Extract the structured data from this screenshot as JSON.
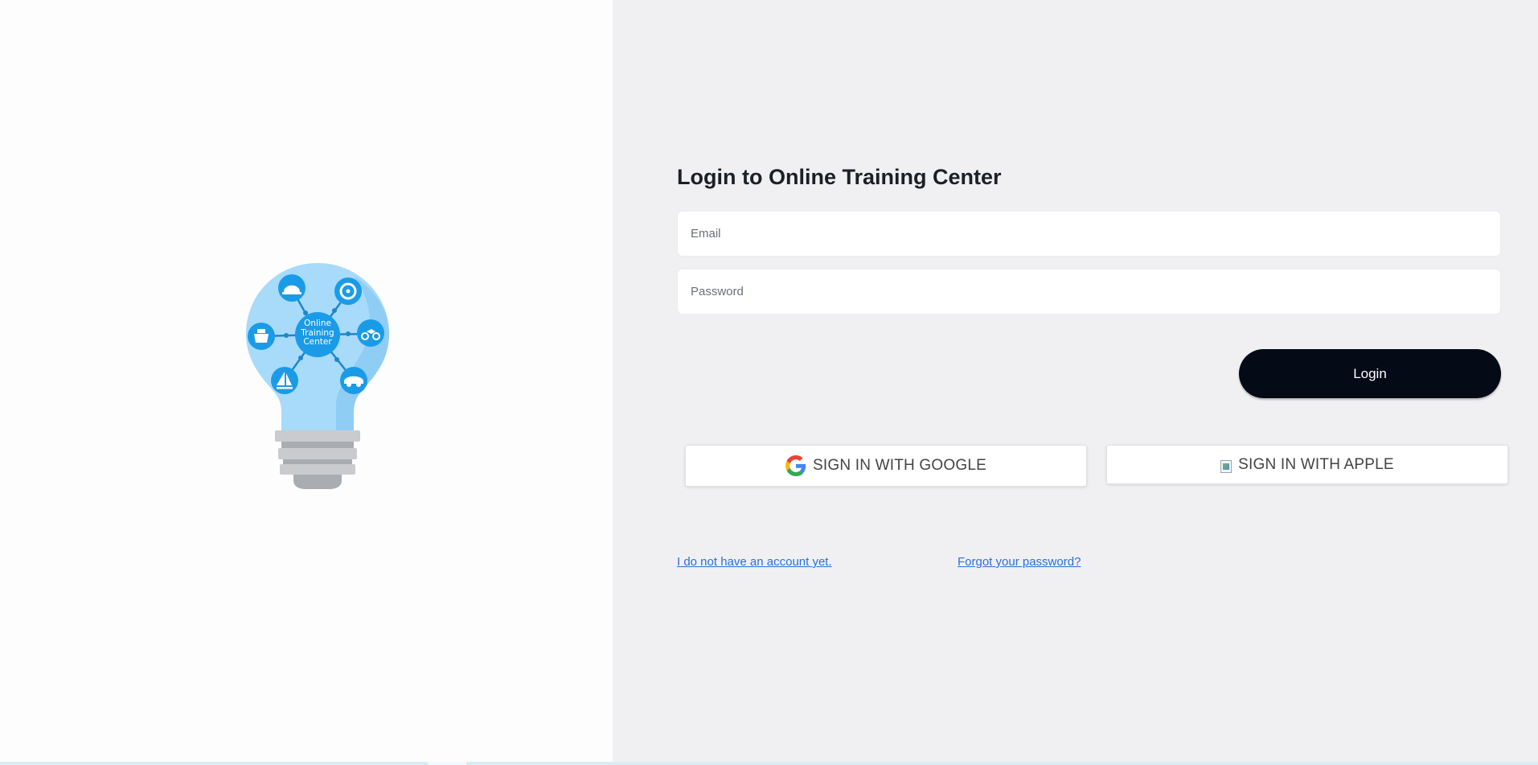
{
  "logo": {
    "center_text": [
      "Online",
      "Training",
      "Center"
    ],
    "icons": [
      "hard-hat-icon",
      "steering-wheel-icon",
      "motorcycle-icon",
      "car-icon",
      "sailboat-icon",
      "ship-icon"
    ]
  },
  "login": {
    "title": "Login to Online Training Center",
    "email_placeholder": "Email",
    "password_placeholder": "Password",
    "login_label": "Login"
  },
  "social": {
    "google_label": "SIGN IN WITH GOOGLE",
    "apple_label": "SIGN IN WITH APPLE"
  },
  "links": {
    "signup": "I do not have an account yet.",
    "forgot": "Forgot your password?"
  },
  "colors": {
    "left_bg": "#fdfdfd",
    "right_bg": "#f0f0f2",
    "primary_button": "#050a17",
    "link": "#2c6fd6",
    "bulb_light": "#a8dafa",
    "bulb_accent": "#1a9be8"
  }
}
